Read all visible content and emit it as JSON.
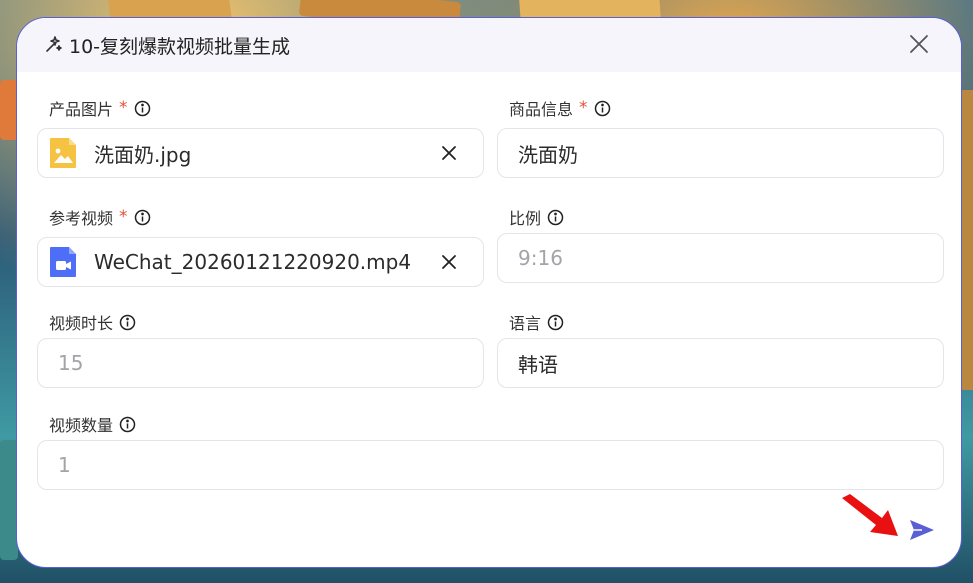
{
  "modal": {
    "title": "10-复刻爆款视频批量生成"
  },
  "fields": {
    "product_image": {
      "label": "产品图片",
      "required": "*",
      "file_name": "洗面奶.jpg"
    },
    "product_info": {
      "label": "商品信息",
      "required": "*",
      "value": "洗面奶"
    },
    "reference_video": {
      "label": "参考视频",
      "required": "*",
      "file_name": "WeChat_20260121220920.mp4"
    },
    "ratio": {
      "label": "比例",
      "placeholder": "9:16"
    },
    "video_duration": {
      "label": "视频时长",
      "placeholder": "15"
    },
    "language": {
      "label": "语言",
      "value": "韩语"
    },
    "video_count": {
      "label": "视频数量",
      "placeholder": "1"
    }
  },
  "icons": {
    "header": "sparkle-icon",
    "close": "close-icon",
    "info": "info-icon",
    "image_file": "image-file-icon",
    "video_file": "video-file-icon",
    "clear": "clear-icon",
    "send": "send-icon",
    "annotation": "red-arrow-icon"
  },
  "colors": {
    "accent": "#5a5fd6",
    "required": "#e8503a",
    "image_file": "#f5c242",
    "video_file": "#4f6ef7",
    "annotation_arrow": "#e81010"
  }
}
